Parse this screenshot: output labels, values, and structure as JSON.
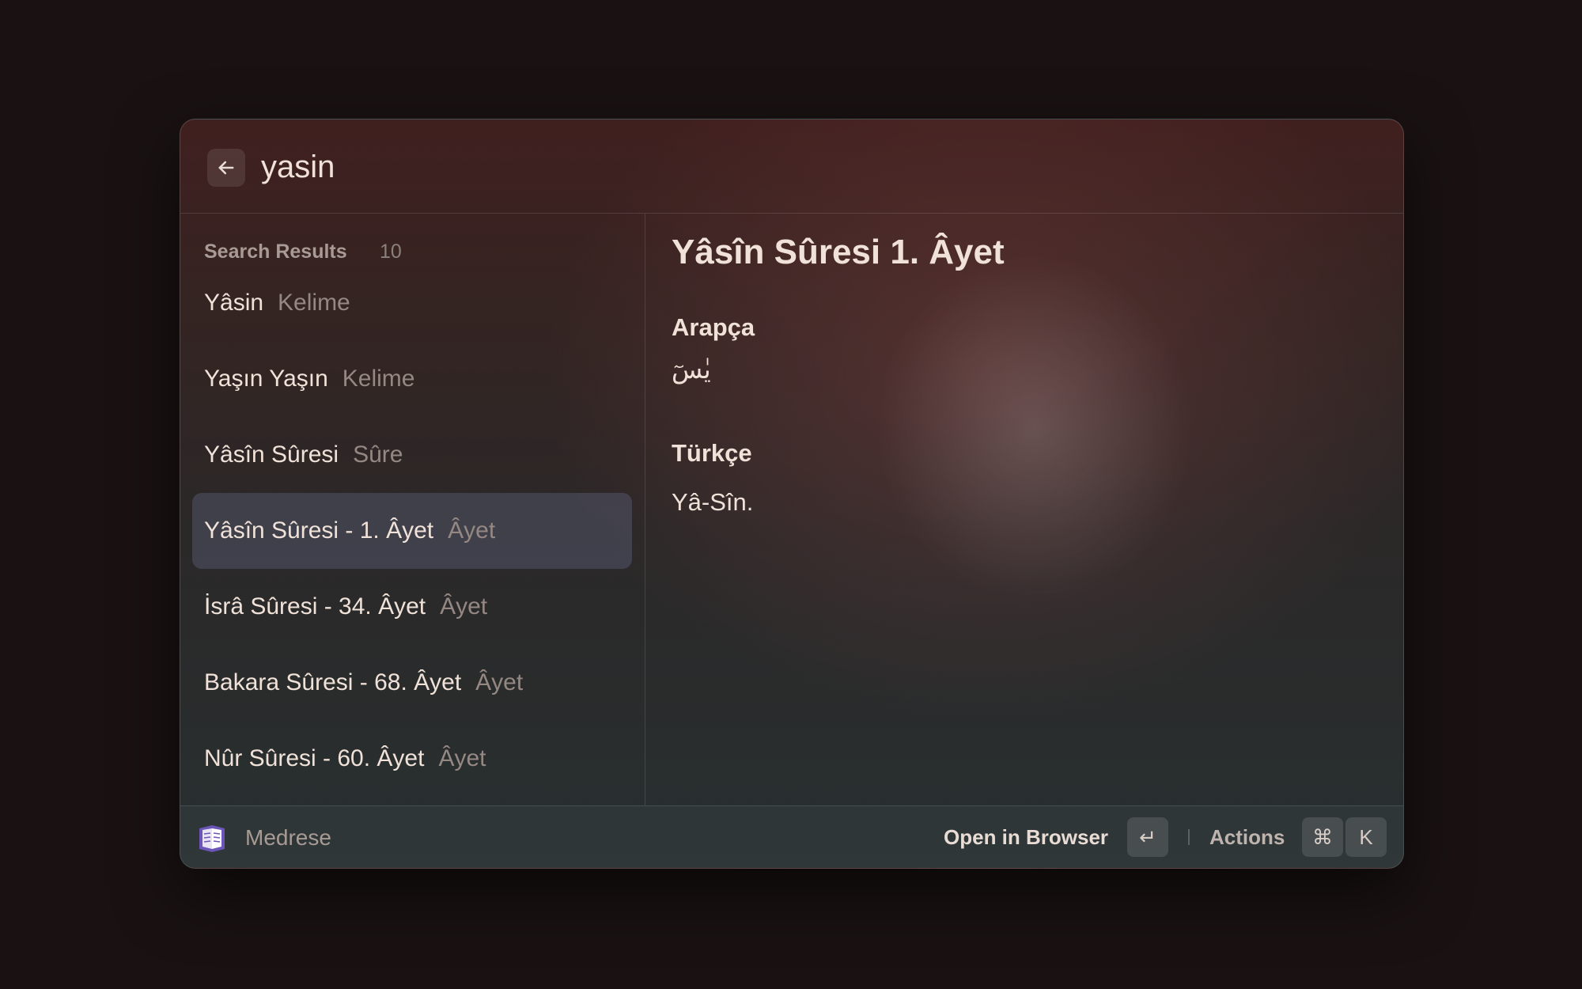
{
  "search": {
    "query": "yasin",
    "back_icon": "arrow-left-icon"
  },
  "results": {
    "header": "Search Results",
    "count": "10",
    "items": [
      {
        "title": "Yâsin",
        "type": "Kelime"
      },
      {
        "title": "Yaşın Yaşın",
        "type": "Kelime"
      },
      {
        "title": "Yâsîn Sûresi",
        "type": "Sûre"
      },
      {
        "title": "Yâsîn Sûresi - 1. Âyet",
        "type": "Âyet",
        "selected": true
      },
      {
        "title": "İsrâ Sûresi - 34. Âyet",
        "type": "Âyet"
      },
      {
        "title": "Bakara Sûresi - 68. Âyet",
        "type": "Âyet"
      },
      {
        "title": "Nûr Sûresi - 60. Âyet",
        "type": "Âyet"
      }
    ]
  },
  "detail": {
    "title": "Yâsîn Sûresi 1. Âyet",
    "arabic_label": "Arapça",
    "arabic_text": "يٰسٓ",
    "turkish_label": "Türkçe",
    "turkish_text": "Yâ-Sîn."
  },
  "footer": {
    "extension_name": "Medrese",
    "extension_icon": "book-icon",
    "primary_action": "Open in Browser",
    "enter_key": "↵",
    "actions_label": "Actions",
    "cmd_key": "⌘",
    "k_key": "K"
  },
  "colors": {
    "selection": "#3b3e4c",
    "text_primary": "#f0e2d8",
    "text_secondary": "#958883",
    "icon_purple": "#6b55b8"
  }
}
